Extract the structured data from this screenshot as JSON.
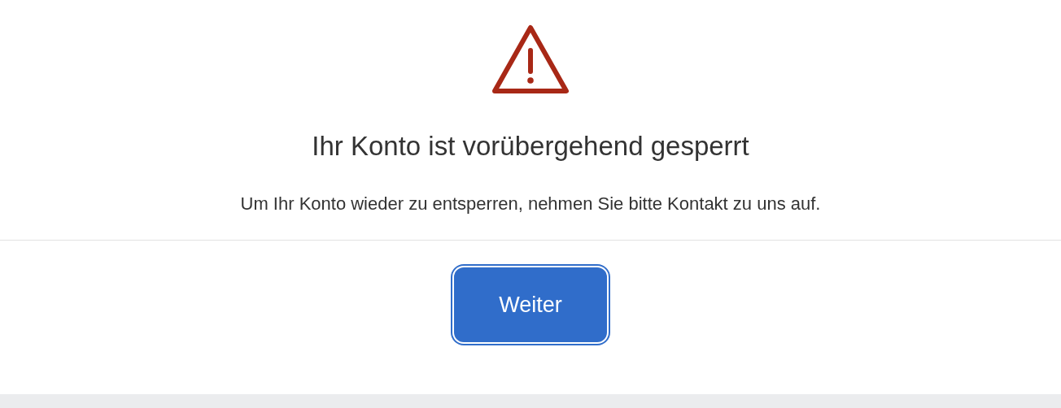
{
  "dialog": {
    "title": "Ihr Konto ist vorübergehend gesperrt",
    "message": "Um Ihr Konto wieder zu entsperren, nehmen Sie bitte Kontakt zu uns auf.",
    "buttons": [
      {
        "label": "Weiter"
      }
    ]
  }
}
